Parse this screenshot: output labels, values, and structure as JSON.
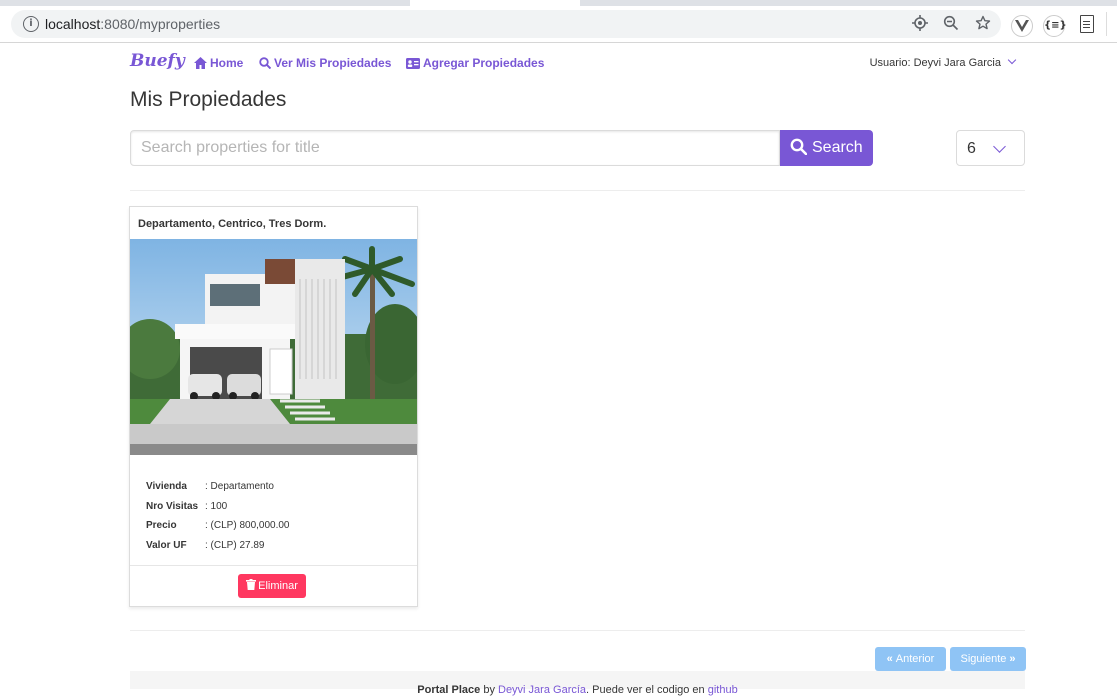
{
  "browser": {
    "url_host": "localhost",
    "url_path": ":8080/myproperties",
    "ext_json_label": "{≡}"
  },
  "nav": {
    "brand": "Buefy",
    "home": "Home",
    "my_properties": "Ver Mis Propiedades",
    "add_property": "Agregar Propiedades",
    "user": "Usuario: Deyvi Jara Garcia"
  },
  "page": {
    "title": "Mis Propiedades"
  },
  "search": {
    "placeholder": "Search properties for title",
    "button_label": "Search",
    "per_page": "6"
  },
  "properties": [
    {
      "title": "Departamento, Centrico, Tres Dorm.",
      "fields": [
        {
          "label": "Vivienda",
          "value": ": Departamento"
        },
        {
          "label": "Nro Visitas",
          "value": ": 100"
        },
        {
          "label": "Precio",
          "value": ": (CLP) 800,000.00"
        },
        {
          "label": "Valor UF",
          "value": ": (CLP) 27.89"
        }
      ],
      "delete_label": "Eliminar"
    }
  ],
  "pagination": {
    "prev": "Anterior",
    "next": "Siguiente"
  },
  "footer": {
    "brand": "Portal Place",
    "by": " by ",
    "author": "Deyvi Jara García",
    "text": ". Puede ver el codigo en ",
    "link": "github"
  },
  "colors": {
    "primary": "#7957d5",
    "danger": "#ff3860",
    "info_light": "#8fc4f5"
  }
}
